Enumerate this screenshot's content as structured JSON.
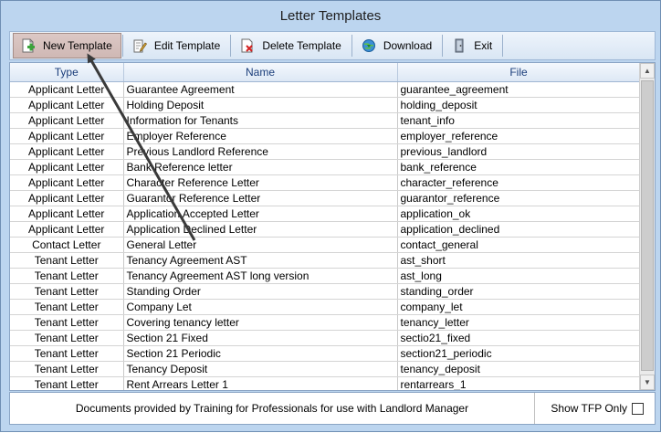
{
  "window": {
    "title": "Letter Templates"
  },
  "toolbar": {
    "buttons": [
      {
        "label": "New Template"
      },
      {
        "label": "Edit Template"
      },
      {
        "label": "Delete Template"
      },
      {
        "label": "Download"
      },
      {
        "label": "Exit"
      }
    ]
  },
  "grid": {
    "columns": [
      "Type",
      "Name",
      "File"
    ],
    "rows": [
      [
        "Applicant Letter",
        "Guarantee Agreement",
        "guarantee_agreement"
      ],
      [
        "Applicant Letter",
        "Holding Deposit",
        "holding_deposit"
      ],
      [
        "Applicant Letter",
        "Information for Tenants",
        "tenant_info"
      ],
      [
        "Applicant Letter",
        "Employer Reference",
        "employer_reference"
      ],
      [
        "Applicant Letter",
        "Previous Landlord Reference",
        "previous_landlord"
      ],
      [
        "Applicant Letter",
        "Bank Reference letter",
        "bank_reference"
      ],
      [
        "Applicant Letter",
        "Character Reference Letter",
        "character_reference"
      ],
      [
        "Applicant Letter",
        "Guarantor Reference Letter",
        "guarantor_reference"
      ],
      [
        "Applicant Letter",
        "Application Accepted Letter",
        "application_ok"
      ],
      [
        "Applicant Letter",
        "Application Declined Letter",
        "application_declined"
      ],
      [
        "Contact Letter",
        "General Letter",
        "contact_general"
      ],
      [
        "Tenant Letter",
        "Tenancy Agreement AST",
        "ast_short"
      ],
      [
        "Tenant Letter",
        "Tenancy Agreement AST long version",
        "ast_long"
      ],
      [
        "Tenant Letter",
        "Standing Order",
        "standing_order"
      ],
      [
        "Tenant Letter",
        "Company Let",
        "company_let"
      ],
      [
        "Tenant Letter",
        "Covering tenancy letter",
        "tenancy_letter"
      ],
      [
        "Tenant Letter",
        "Section 21 Fixed",
        "sectio21_fixed"
      ],
      [
        "Tenant Letter",
        "Section 21 Periodic",
        "section21_periodic"
      ],
      [
        "Tenant Letter",
        "Tenancy Deposit",
        "tenancy_deposit"
      ],
      [
        "Tenant Letter",
        "Rent Arrears Letter 1",
        "rentarrears_1"
      ]
    ]
  },
  "footer": {
    "note": "Documents provided by Training for Professionals for use with Landlord Manager",
    "checkbox_label": "Show TFP Only",
    "checkbox_checked": false
  },
  "icons": [
    "new-document-icon",
    "edit-document-icon",
    "delete-document-icon",
    "download-globe-icon",
    "exit-door-icon",
    "annotation-arrow"
  ],
  "colors": {
    "window_bg": "#bcd5ef",
    "header_text": "#1a3d7a",
    "active_button": "#d4bfbb",
    "annotation_arrow": "#3a3a3a"
  }
}
